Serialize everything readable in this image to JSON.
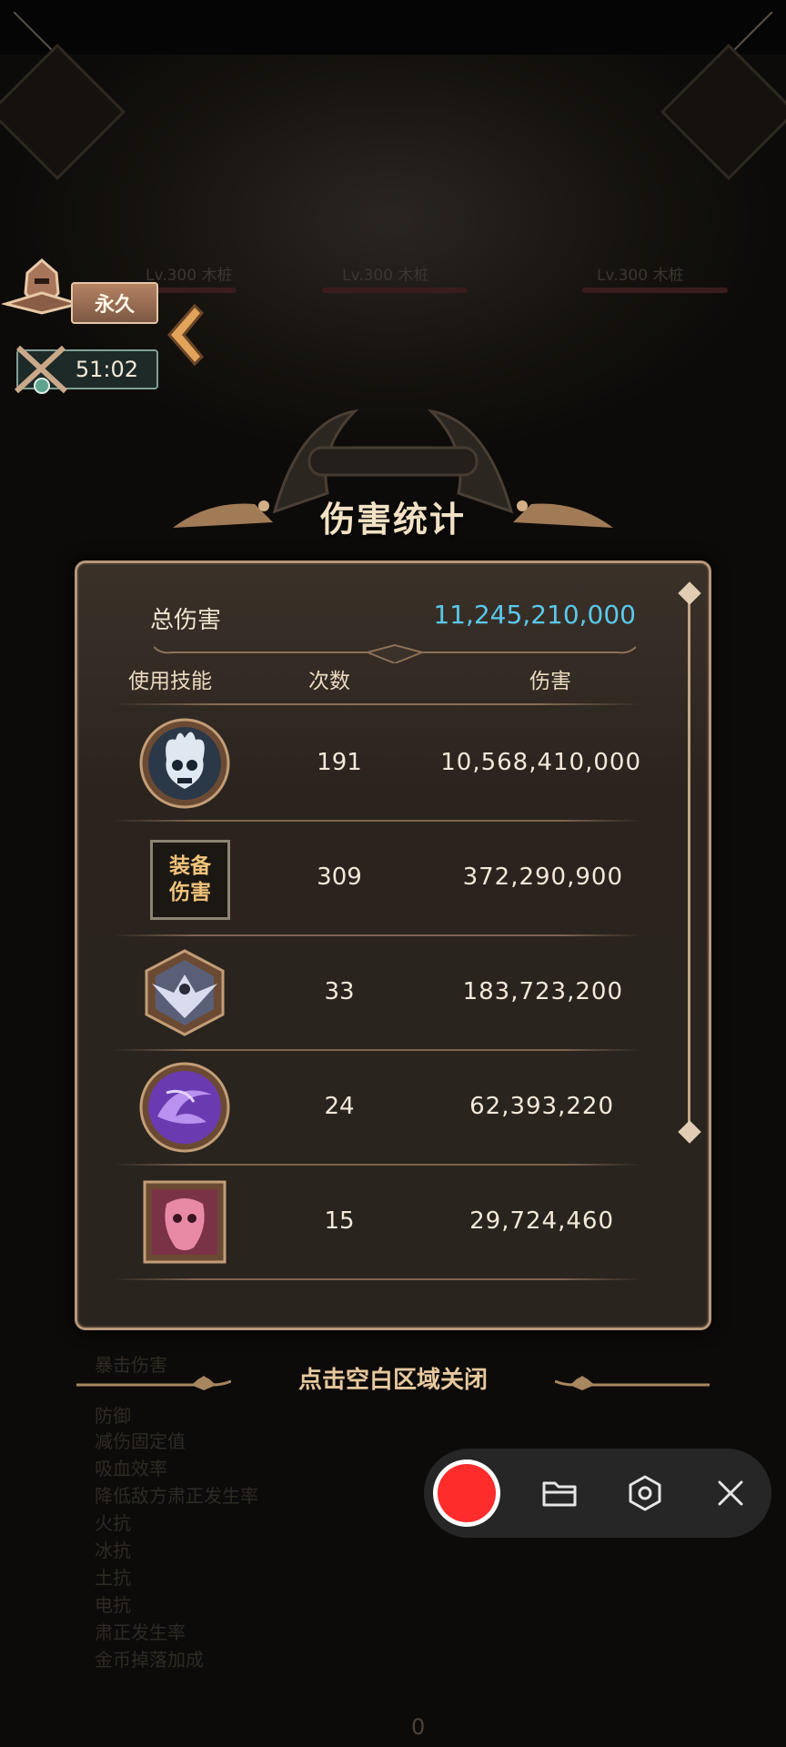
{
  "sidebar": {
    "buff_label": "永久",
    "timer": "51:02"
  },
  "background": {
    "enemy_labels": [
      "Lv.300 木桩",
      "Lv.300 木桩",
      "Lv.300 木桩"
    ]
  },
  "panel": {
    "title": "伤害统计",
    "total_label": "总伤害",
    "total_value": "11,245,210,000",
    "headers": {
      "skill": "使用技能",
      "count": "次数",
      "damage": "伤害"
    },
    "rows": [
      {
        "icon": "flaming-skull-icon",
        "count": "191",
        "damage": "10,568,410,000"
      },
      {
        "icon": "equipment-tile",
        "tile_line1": "装备",
        "tile_line2": "伤害",
        "count": "309",
        "damage": "372,290,900"
      },
      {
        "icon": "winged-creature-icon",
        "count": "33",
        "damage": "183,723,200"
      },
      {
        "icon": "purple-vortex-icon",
        "count": "24",
        "damage": "62,393,220"
      },
      {
        "icon": "demon-face-icon",
        "count": "15",
        "damage": "29,724,460"
      }
    ]
  },
  "close_hint": "点击空白区域关闭",
  "recorder": {
    "buttons": [
      "record-icon",
      "folder-icon",
      "settings-icon",
      "close-icon"
    ]
  },
  "footer_digit": "0",
  "colors": {
    "accent_blue": "#5ac8ea",
    "panel_border": "#b8977a",
    "record_red": "#ff2c2c"
  }
}
